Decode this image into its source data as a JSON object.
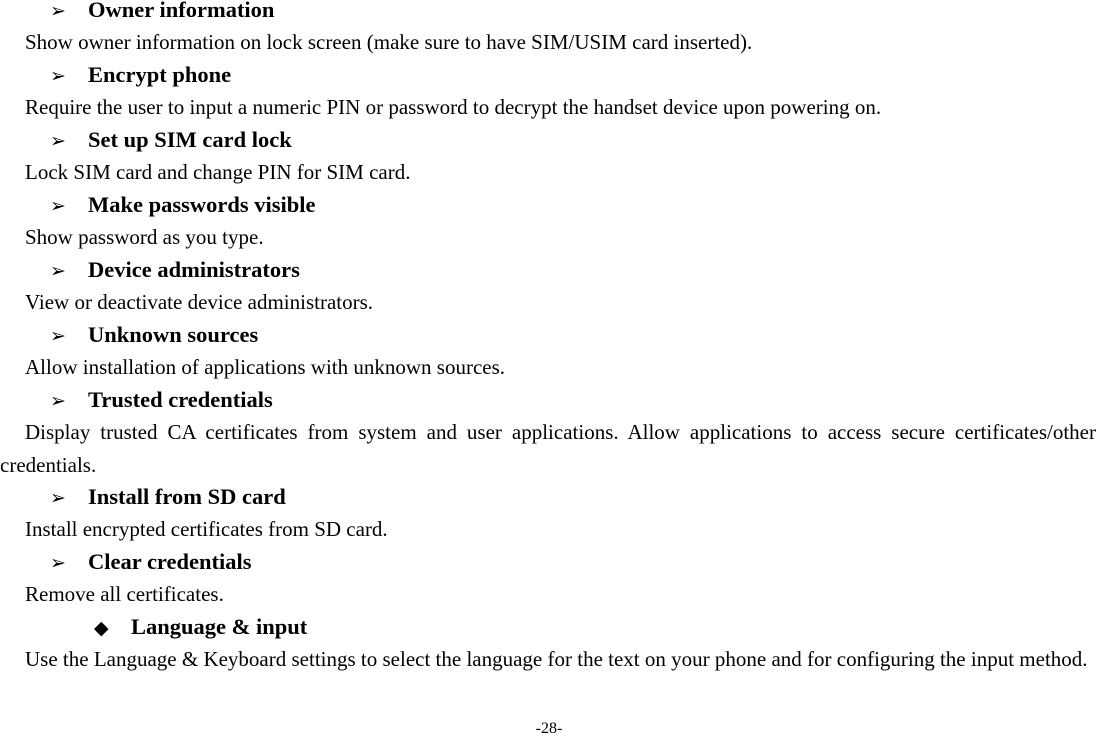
{
  "page": {
    "page_number": "-28-",
    "sections": [
      {
        "bullet_icon": "arrowhead-bullet",
        "bullet_glyph": "➢",
        "title": "Owner information",
        "text": "Show owner information on lock screen (make sure to have SIM/USIM card inserted)."
      },
      {
        "bullet_icon": "arrowhead-bullet",
        "bullet_glyph": "➢",
        "title": "Encrypt phone",
        "text": "Require the user to input a numeric PIN or password to decrypt the handset device upon powering on."
      },
      {
        "bullet_icon": "arrowhead-bullet",
        "bullet_glyph": "➢",
        "title": "Set up SIM card lock",
        "text": "Lock SIM card and change PIN for SIM card."
      },
      {
        "bullet_icon": "arrowhead-bullet",
        "bullet_glyph": "➢",
        "title": "Make passwords visible",
        "text": "Show password as you type."
      },
      {
        "bullet_icon": "arrowhead-bullet",
        "bullet_glyph": "➢",
        "title": "Device administrators",
        "text": "View or deactivate device administrators."
      },
      {
        "bullet_icon": "arrowhead-bullet",
        "bullet_glyph": "➢",
        "title": "Unknown sources",
        "text": "Allow installation of applications with unknown sources."
      },
      {
        "bullet_icon": "arrowhead-bullet",
        "bullet_glyph": "➢",
        "title": "Trusted credentials",
        "text": "Display trusted CA certificates from system and user applications. Allow applications to access secure certificates/other credentials."
      },
      {
        "bullet_icon": "arrowhead-bullet",
        "bullet_glyph": "➢",
        "title": "Install from SD card",
        "text": "Install encrypted certificates from SD card."
      },
      {
        "bullet_icon": "arrowhead-bullet",
        "bullet_glyph": "➢",
        "title": "Clear credentials",
        "text": "Remove all certificates."
      },
      {
        "bullet_icon": "diamond-bullet",
        "bullet_glyph": "◆",
        "title": "Language & input",
        "text": "Use the Language & Keyboard settings to select the language for the text on your phone and for configuring the input method."
      }
    ]
  }
}
